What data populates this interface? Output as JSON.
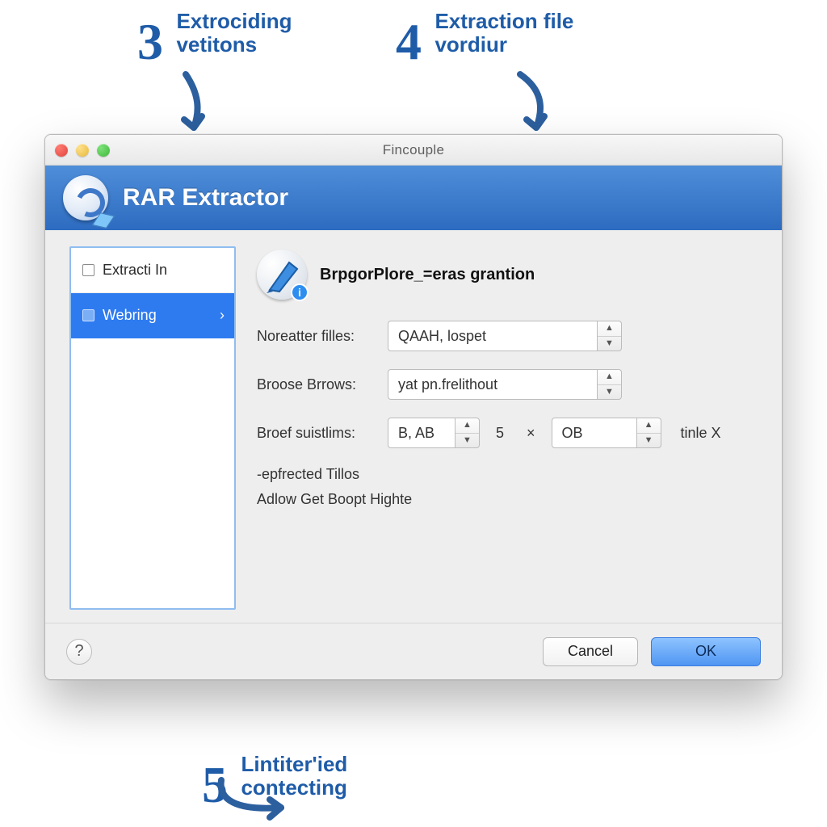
{
  "annotations": {
    "a3": {
      "digit": "3",
      "line1": "Extrociding",
      "line2": "vetitons"
    },
    "a4": {
      "digit": "4",
      "line1": "Extraction file",
      "line2": "vordiur"
    },
    "a5": {
      "digit": "5",
      "line1": "Lintiter'ied",
      "line2": "contecting"
    }
  },
  "window": {
    "title": "Fincouple",
    "header": "RAR Extractor"
  },
  "sidebar": {
    "items": [
      {
        "label": "Extracti In",
        "selected": false
      },
      {
        "label": "Webring",
        "selected": true
      }
    ]
  },
  "main": {
    "heading": "BrpgorPlore_=eras grantion",
    "rows": {
      "r1": {
        "label": "Noreatter filles:",
        "value": "QAAH, lospet"
      },
      "r2": {
        "label": "Broose Brrows:",
        "value": "yat pn.frelithout"
      },
      "r3": {
        "label": "Broef suistlims:",
        "valA": "B, AB",
        "valB": "5",
        "valC": "OB",
        "suffix": "tinle X"
      }
    },
    "line1": "-epfrected Tillos",
    "line2": "Adlow Get Boopt Highte"
  },
  "footer": {
    "cancel": "Cancel",
    "ok": "OK"
  }
}
